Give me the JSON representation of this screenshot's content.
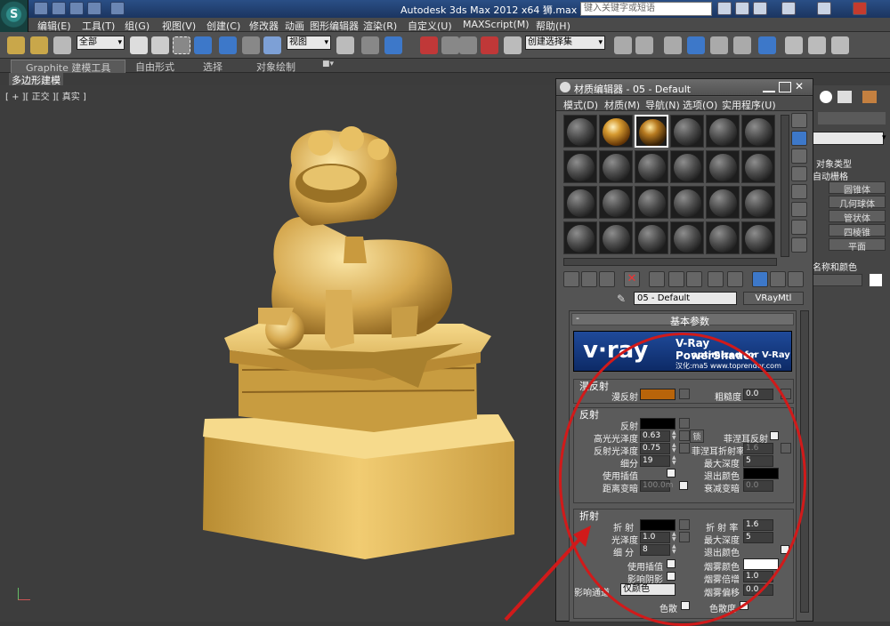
{
  "titlebar": {
    "title": "Autodesk 3ds Max  2012 x64     狮.max",
    "search_placeholder": "键入关键字或短语"
  },
  "menu": [
    "编辑(E)",
    "工具(T)",
    "组(G)",
    "视图(V)",
    "创建(C)",
    "修改器",
    "动画",
    "图形编辑器",
    "渲染(R)",
    "自定义(U)",
    "MAXScript(M)",
    "帮助(H)"
  ],
  "toolbar": {
    "selection_filter": "全部",
    "ref_coord": "视图",
    "named_selection": "创建选择集",
    "snap_label": "3"
  },
  "ribbon": {
    "tabs": [
      "Graphite 建模工具",
      "自由形式",
      "选择",
      "对象绘制"
    ],
    "subtab": "多边形建模"
  },
  "viewport": {
    "label": "[ + ][ 正交 ][ 真实 ]"
  },
  "command_panel": {
    "object_type": "对象类型",
    "auto_grid": "自动栅格",
    "items": [
      "圆锥体",
      "几何球体",
      "管状体",
      "四棱锥",
      "平面"
    ],
    "name_color": "名称和颜色"
  },
  "material_editor": {
    "title": "材质编辑器 - 05 - Default",
    "menu": [
      "模式(D)",
      "材质(M)",
      "导航(N)",
      "选项(O)",
      "实用程序(U)"
    ],
    "material_name": "05 - Default",
    "material_type": "VRayMtl",
    "rollout_title": "基本参数",
    "vray_banner": {
      "logo": "v·ray",
      "product": "V-Ray PowerShader",
      "tagline": "optimized for V-Ray",
      "credit": "汉化:ma5 www.toprender.com"
    },
    "diffuse": {
      "group": "漫反射",
      "diffuse_label": "漫反射",
      "roughness_label": "粗糙度",
      "roughness": "0.0",
      "color": "#b8640a"
    },
    "reflection": {
      "group": "反射",
      "reflect_label": "反射",
      "hilight_gloss_label": "高光光泽度",
      "hilight_gloss": "0.63",
      "lock_label": "锁",
      "fresnel_label": "菲涅耳反射",
      "refl_gloss_label": "反射光泽度",
      "refl_gloss": "0.75",
      "fresnel_ior_label": "菲涅耳折射率",
      "fresnel_ior": "1.6",
      "subdivs_label": "细分",
      "subdivs": "19",
      "max_depth_label": "最大深度",
      "max_depth": "5",
      "use_interp_label": "使用插值",
      "exit_color_label": "退出颜色",
      "dim_distance_label": "距离变暗",
      "dim_distance": "100.0m",
      "dim_falloff_label": "衰减变暗",
      "dim_falloff": "0.0"
    },
    "refraction": {
      "group": "折射",
      "refract_label": "折 射",
      "ior_label": "折 射 率",
      "ior": "1.6",
      "gloss_label": "光泽度",
      "gloss": "1.0",
      "max_depth_label": "最大深度",
      "max_depth": "5",
      "subdivs_label": "细 分",
      "subdivs": "8",
      "exit_color_label": "退出颜色",
      "use_interp_label": "使用插值",
      "fog_color_label": "烟雾颜色",
      "affect_shadows_label": "影响阴影",
      "fog_mult_label": "烟雾倍增",
      "fog_mult": "1.0",
      "affect_channels_label": "影响通道",
      "affect_channels": "仅颜色",
      "fog_bias_label": "烟雾偏移",
      "fog_bias": "0.0",
      "dispersion_label": "色散",
      "abbe_label": "色散度"
    }
  },
  "colors": {
    "annotation": "#d11a1a",
    "gold": "#d6a94a"
  }
}
